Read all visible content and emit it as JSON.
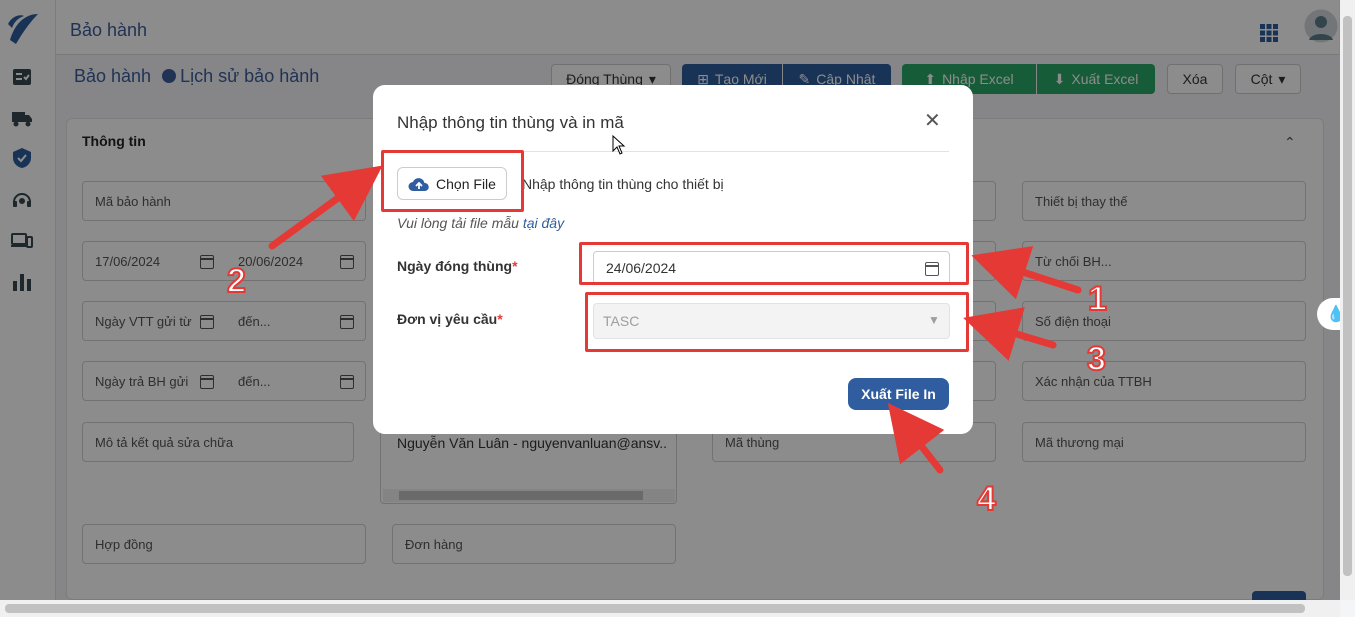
{
  "header": {
    "title": "Bảo hành"
  },
  "breadcrumb": {
    "current": "Bảo hành",
    "link": "Lịch sử bảo hành"
  },
  "toolbar": {
    "dong_thung": "Đóng Thùng",
    "tao_moi": "Tạo Mới",
    "cap_nhat": "Cập Nhật",
    "nhap_excel": "Nhập Excel",
    "xuat_excel": "Xuất Excel",
    "xoa": "Xóa",
    "cot": "Cột"
  },
  "panel": {
    "title": "Thông tin",
    "fields": {
      "ma_bao_hanh": "Mã bảo hành",
      "date_from": "17/06/2024",
      "date_to": "20/06/2024",
      "ngay_vtt": "Ngày VTT gửi từ",
      "den1": "đến...",
      "ngay_tra": "Ngày trả BH gửi",
      "den2": "đến...",
      "mo_ta": "Mô tả kết quả sửa chữa",
      "user": "Nguyễn Văn Luân - nguyenvanluan@ansv...",
      "ma_thung": "Mã thùng",
      "thiet_bi_thay_the": "Thiết bị thay thế",
      "tu_choi": "Từ chối BH...",
      "so_dien_thoai": "Số điện thoại",
      "xac_nhan": "Xác nhận của TTBH",
      "ma_thuong_mai": "Mã thương mại",
      "hop_dong": "Hợp đồng",
      "don_hang": "Đơn hàng"
    }
  },
  "modal": {
    "title": "Nhập thông tin thùng và in mã",
    "choose_file": "Chọn File",
    "file_hint": "Nhập thông tin thùng cho thiết bị",
    "template_note": "Vui lòng tải file mẫu",
    "template_link": "tại đây",
    "date_label": "Ngày đóng thùng",
    "date_value": "24/06/2024",
    "unit_label": "Đơn vị yêu cầu",
    "unit_value": "TASC",
    "export_button": "Xuất File In",
    "required_mark": "*"
  },
  "annotations": [
    "1",
    "2",
    "3",
    "4"
  ],
  "colors": {
    "primary": "#2f5d9f",
    "success": "#2aa866",
    "annotation": "#e53935"
  }
}
